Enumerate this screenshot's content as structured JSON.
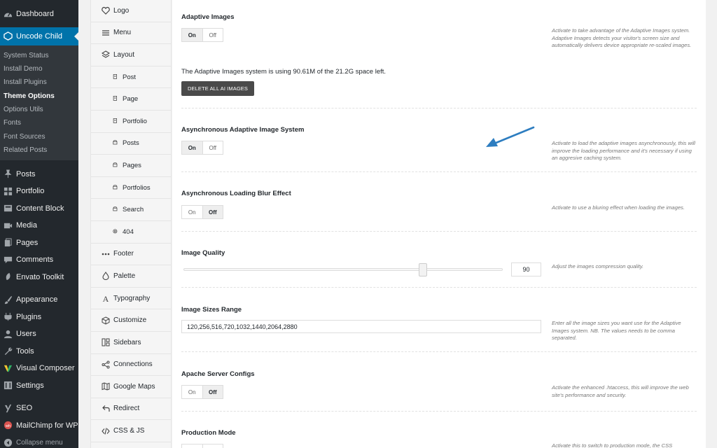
{
  "wp_menu": {
    "dashboard": "Dashboard",
    "uncode_child": "Uncode Child",
    "submenu": [
      "System Status",
      "Install Demo",
      "Install Plugins",
      "Theme Options",
      "Options Utils",
      "Fonts",
      "Font Sources",
      "Related Posts"
    ],
    "current_submenu": "Theme Options",
    "items": [
      {
        "label": "Posts",
        "icon": "pin-icon"
      },
      {
        "label": "Portfolio",
        "icon": "grid-icon"
      },
      {
        "label": "Content Block",
        "icon": "block-icon"
      },
      {
        "label": "Media",
        "icon": "media-icon"
      },
      {
        "label": "Pages",
        "icon": "page-icon"
      },
      {
        "label": "Comments",
        "icon": "comment-icon"
      },
      {
        "label": "Envato Toolkit",
        "icon": "envato-icon"
      }
    ],
    "items2": [
      {
        "label": "Appearance",
        "icon": "brush-icon"
      },
      {
        "label": "Plugins",
        "icon": "plug-icon"
      },
      {
        "label": "Users",
        "icon": "users-icon"
      },
      {
        "label": "Tools",
        "icon": "wrench-icon"
      },
      {
        "label": "Visual Composer",
        "icon": "vc-icon"
      },
      {
        "label": "Settings",
        "icon": "settings-icon"
      }
    ],
    "items3": [
      {
        "label": "SEO",
        "icon": "yoast-icon"
      },
      {
        "label": "MailChimp for WP",
        "icon": "mailchimp-icon"
      }
    ],
    "collapse": "Collapse menu"
  },
  "tabs": [
    {
      "label": "Logo",
      "icon": "heart-icon",
      "sub": false
    },
    {
      "label": "Menu",
      "icon": "menu-icon",
      "sub": false
    },
    {
      "label": "Layout",
      "icon": "layers-icon",
      "sub": false
    },
    {
      "label": "Post",
      "icon": "doc-icon",
      "sub": true
    },
    {
      "label": "Page",
      "icon": "doc-icon",
      "sub": true
    },
    {
      "label": "Portfolio",
      "icon": "doc-icon",
      "sub": true
    },
    {
      "label": "Posts",
      "icon": "archive-icon",
      "sub": true
    },
    {
      "label": "Pages",
      "icon": "archive-icon",
      "sub": true
    },
    {
      "label": "Portfolios",
      "icon": "archive-icon",
      "sub": true
    },
    {
      "label": "Search",
      "icon": "archive-icon",
      "sub": true
    },
    {
      "label": "404",
      "icon": "at-icon",
      "sub": true
    },
    {
      "label": "Footer",
      "icon": "dots-icon",
      "sub": false
    },
    {
      "label": "Palette",
      "icon": "drop-icon",
      "sub": false
    },
    {
      "label": "Typography",
      "icon": "type-icon",
      "sub": false
    },
    {
      "label": "Customize",
      "icon": "cube-icon",
      "sub": false
    },
    {
      "label": "Sidebars",
      "icon": "sidebars-icon",
      "sub": false
    },
    {
      "label": "Connections",
      "icon": "share-icon",
      "sub": false
    },
    {
      "label": "Google Maps",
      "icon": "map-icon",
      "sub": false
    },
    {
      "label": "Redirect",
      "icon": "redirect-icon",
      "sub": false
    },
    {
      "label": "CSS & JS",
      "icon": "code-icon",
      "sub": false
    }
  ],
  "options": {
    "adaptive_images": {
      "title": "Adaptive Images",
      "on": "On",
      "off": "Off",
      "value": "On",
      "desc": "Activate to take advantage of the Adaptive Images system. Adaptive Images detects your visitor's screen size and automatically delivers device appropriate re-scaled images.",
      "usage_text": "The Adaptive Images system is using 90.61M of the 21.2G space left.",
      "delete_button": "DELETE ALL AI IMAGES"
    },
    "async_adaptive": {
      "title": "Asynchronous Adaptive Image System",
      "on": "On",
      "off": "Off",
      "value": "On",
      "desc": "Activate to load the adaptive images asynchronously, this will improve the loading performance and it's necessary if using an aggresive caching system."
    },
    "async_blur": {
      "title": "Asynchronous Loading Blur Effect",
      "on": "On",
      "off": "Off",
      "value": "Off",
      "desc": "Activate to use a bluring effect when loading the images."
    },
    "image_quality": {
      "title": "Image Quality",
      "value": "90",
      "slider_fraction": 0.75,
      "desc": "Adjust the images compression quality."
    },
    "image_sizes": {
      "title": "Image Sizes Range",
      "value": "120,256,516,720,1032,1440,2064,2880",
      "desc": "Enter all the image sizes you want use for the Adaptive Images system. NB. The values needs to be comma separated."
    },
    "apache": {
      "title": "Apache Server Configs",
      "on": "On",
      "off": "Off",
      "value": "Off",
      "desc": "Activate the enhanced .htaccess, this will improve the web site's performance and security."
    },
    "production": {
      "title": "Production Mode",
      "desc": "Activate this to switch to production mode, the CSS"
    }
  },
  "colors": {
    "wp_sidebar": "#23282d",
    "wp_submenu": "#32373c",
    "wp_active": "#0073aa",
    "annotation_arrow": "#2d7dc0"
  }
}
